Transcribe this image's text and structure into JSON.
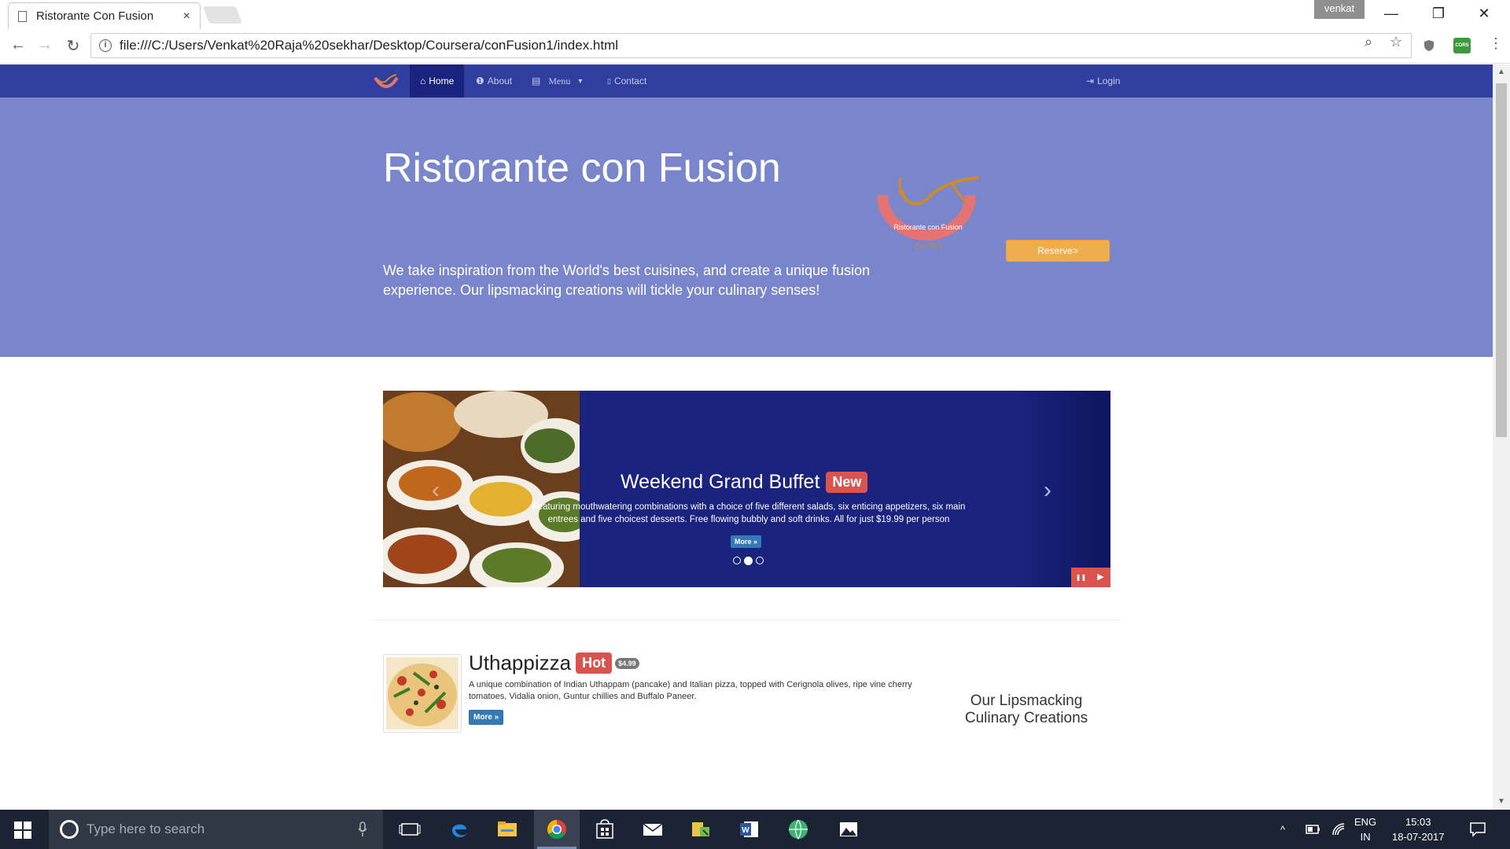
{
  "browser": {
    "tab_title": "Ristorante Con Fusion",
    "tab_close": "×",
    "user_chip": "venkat",
    "url": "file:///C:/Users/Venkat%20Raja%20sekhar/Desktop/Coursera/conFusion1/index.html",
    "minimize": "—",
    "restore": "❐",
    "close": "✕",
    "back": "←",
    "forward": "→",
    "reload": "↻",
    "info_glyph": "i",
    "zoom_glyph": "⌕",
    "star_glyph": "☆",
    "menu_glyph": "⋮",
    "extension_label": "CORS"
  },
  "site_nav": {
    "items": [
      {
        "label": "Home",
        "icon": "home-icon",
        "glyph": "⌂",
        "active": true
      },
      {
        "label": "About",
        "icon": "info-circle-icon",
        "glyph": "❶",
        "active": false
      },
      {
        "label": "Menu",
        "icon": "list-icon",
        "glyph": "▤",
        "active": false
      },
      {
        "label": "Contact",
        "icon": "envelope-icon",
        "glyph": "▯",
        "active": false
      }
    ],
    "dropdown_caret": "▾",
    "login": {
      "label": "Login",
      "icon": "login-icon",
      "glyph": "⇥"
    }
  },
  "jumbotron": {
    "title": "Ristorante con Fusion",
    "text": "We take inspiration from the World's best cuisines, and create a unique fusion experience. Our lipsmacking creations will tickle your culinary senses!",
    "logo_text": "Ristorante con Fusion",
    "logo_est": "Est. 2013",
    "reserve_label": "Reserve>"
  },
  "carousel": {
    "title": "Weekend Grand Buffet",
    "label": "New",
    "text": "Featuring mouthwatering combinations with a choice of five different salads, six enticing appetizers, six main entrees and five choicest desserts. Free flowing bubbly and soft drinks. All for just $19.99 per person",
    "more_label": "More »",
    "prev_glyph": "‹",
    "next_glyph": "›",
    "pause_glyph": "❚❚",
    "play_glyph": "▶",
    "slide_count": 3,
    "active_slide": 2
  },
  "dish": {
    "title": "Uthappizza",
    "label": "Hot",
    "price": "$4.99",
    "text": "A unique combination of Indian Uthappam (pancake) and Italian pizza, topped with Cerignola olives, ripe vine cherry tomatoes, Vidalia onion, Guntur chillies and Buffalo Paneer.",
    "more_label": "More »"
  },
  "side_heading": "Our Lipsmacking Culinary Creations",
  "taskbar": {
    "search_placeholder": "Type here to search",
    "lang_line1": "ENG",
    "lang_line2": "IN",
    "time": "15:03",
    "date": "18-07-2017"
  },
  "colors": {
    "nav": "#303f9f",
    "nav_active": "#1a237e",
    "jumbotron": "#7986cb",
    "carousel_bg": "#1a237e",
    "reserve": "#f0ad4e",
    "label_red": "#d9534f",
    "button_blue": "#337ab7"
  }
}
